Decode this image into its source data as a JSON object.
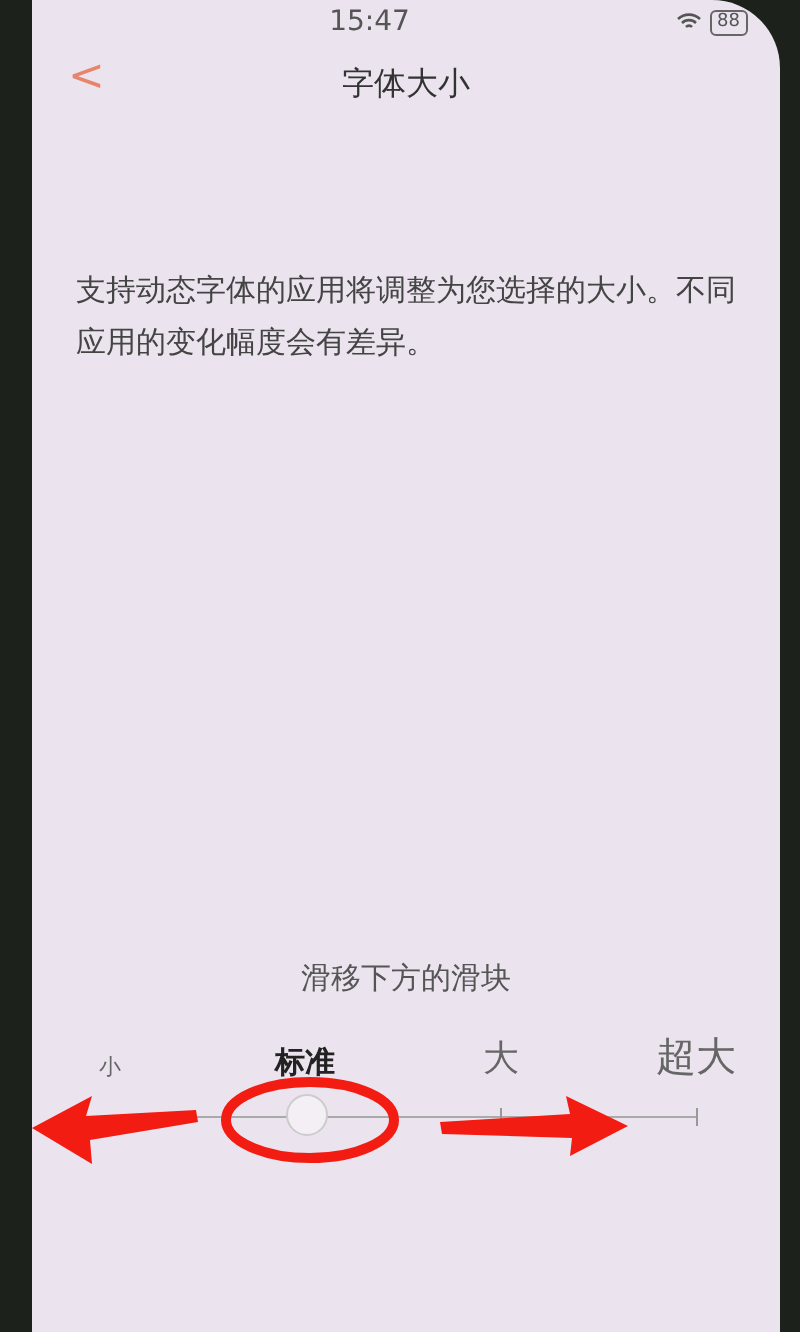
{
  "status_bar": {
    "time": "15:47",
    "battery": "88"
  },
  "header": {
    "back": "<",
    "title": "字体大小"
  },
  "description": "支持动态字体的应用将调整为您选择的大小。不同应用的变化幅度会有差异。",
  "slider": {
    "hint": "滑移下方的滑块",
    "level": 0.3333,
    "stops": [
      {
        "label": "小",
        "selected": false
      },
      {
        "label": "标准",
        "selected": true
      },
      {
        "label": "大",
        "selected": false
      },
      {
        "label": "超大",
        "selected": false
      }
    ]
  }
}
